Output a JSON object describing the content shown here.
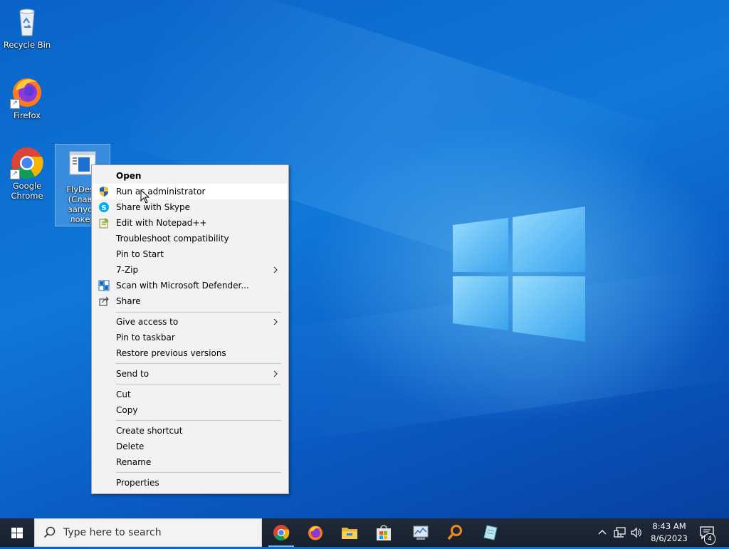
{
  "desktop": {
    "icons": [
      {
        "label": "Recycle Bin"
      },
      {
        "label": "Firefox"
      },
      {
        "label_line1": "Google",
        "label_line2": "Chrome"
      },
      {
        "label_line1": "FlyDesk",
        "label_line2": "(Слава",
        "label_line3": "запуск",
        "label_line4": "локер"
      }
    ]
  },
  "context_menu": {
    "groups": [
      [
        {
          "label": "Open",
          "icon": "",
          "bold": true
        },
        {
          "label": "Run as administrator",
          "icon": "uac-shield-icon",
          "hover": true
        },
        {
          "label": "Share with Skype",
          "icon": "skype-icon"
        },
        {
          "label": "Edit with Notepad++",
          "icon": "notepad-plus-plus-icon"
        },
        {
          "label": "Troubleshoot compatibility",
          "icon": ""
        },
        {
          "label": "Pin to Start",
          "icon": ""
        },
        {
          "label": "7-Zip",
          "icon": "",
          "submenu": true
        },
        {
          "label": "Scan with Microsoft Defender...",
          "icon": "defender-icon"
        },
        {
          "label": "Share",
          "icon": "share-icon"
        }
      ],
      [
        {
          "label": "Give access to",
          "submenu": true
        },
        {
          "label": "Pin to taskbar"
        },
        {
          "label": "Restore previous versions"
        }
      ],
      [
        {
          "label": "Send to",
          "submenu": true
        }
      ],
      [
        {
          "label": "Cut"
        },
        {
          "label": "Copy"
        }
      ],
      [
        {
          "label": "Create shortcut"
        },
        {
          "label": "Delete"
        },
        {
          "label": "Rename"
        }
      ],
      [
        {
          "label": "Properties"
        }
      ]
    ]
  },
  "taskbar": {
    "search_placeholder": "Type here to search",
    "pinned": [
      "chrome-icon",
      "firefox-icon",
      "file-explorer-icon",
      "microsoft-store-icon",
      "task-manager-icon",
      "search-tool-icon",
      "app-icon"
    ],
    "clock_time": "8:43 AM",
    "clock_date": "8/6/2023",
    "notification_count": "4"
  },
  "colors": {
    "taskbar_bg": "#1c2330",
    "menu_bg": "#f2f2f2",
    "menu_hover": "#ffffff",
    "accent": "#0078d7"
  }
}
